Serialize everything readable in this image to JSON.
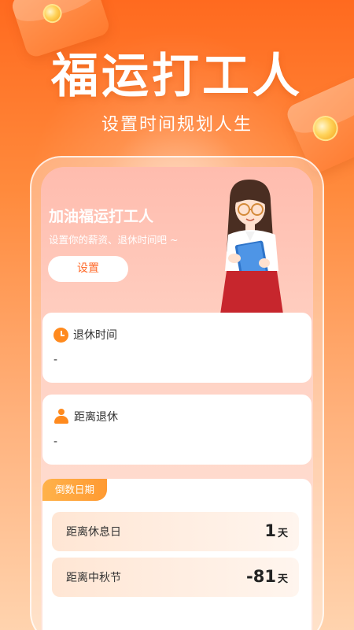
{
  "hero": {
    "title": "福运打工人",
    "subtitle": "设置时间规划人生"
  },
  "greeting": {
    "title": "加油福运打工人",
    "subtitle": "设置你的薪资、退休时间吧 ~",
    "button_label": "设置"
  },
  "retire_card": {
    "label": "退休时间",
    "value": "-",
    "icon": "clock-icon"
  },
  "distance_card": {
    "label": "距离退休",
    "value": "-",
    "icon": "person-icon"
  },
  "countdown": {
    "tag": "倒数日期",
    "rows": [
      {
        "label": "距离休息日",
        "value": "1",
        "unit": "天"
      },
      {
        "label": "距离中秋节",
        "value": "-81",
        "unit": "天"
      }
    ]
  },
  "colors": {
    "accent": "#ff6a1f",
    "icon": "#ff8a1e",
    "tag": "#ffa83c"
  }
}
